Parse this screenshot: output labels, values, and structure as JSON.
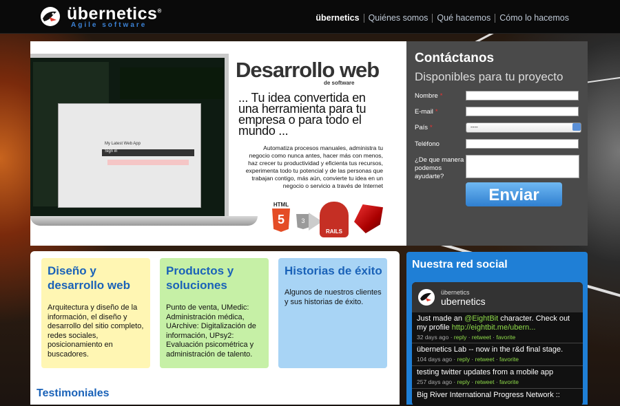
{
  "brand": {
    "name": "übernetics",
    "registered": "®",
    "tagline": "Agile software"
  },
  "nav": {
    "items": [
      "übernetics",
      "Quiénes somos",
      "Qué hacemos",
      "Cómo lo hacemos"
    ]
  },
  "hero": {
    "title": "Desarrollo web",
    "subtitle": "de software",
    "pitch": "... Tu idea convertida en una herramienta para tu empresa o para todo el mundo ...",
    "body": "Automatiza procesos manuales, administra tu negocio como nunca antes, hacer más con menos, haz crecer tu productividad y eficienta tus recursos, experimenta todo tu potencial y de las personas que trabajan contigo, más aún, convierte tu idea en un negocio o servicio a través de Internet",
    "badges": {
      "html": "HTML",
      "html5": "5",
      "css": "3",
      "rails": "RAILS"
    },
    "laptop": {
      "app_title": "My Latest Web App",
      "signin": "Sign in"
    }
  },
  "contact": {
    "title": "Contáctanos",
    "subtitle": "Disponibles para tu proyecto",
    "required_mark": "*",
    "fields": {
      "name_label": "Nombre",
      "email_label": "E-mail",
      "country_label": "País",
      "country_value": "----",
      "phone_label": "Teléfono",
      "message_label": "¿De que manera podemos ayudarte?"
    },
    "submit": "Enviar"
  },
  "cards": [
    {
      "title": "Diseño y desarrollo web",
      "text": "Arquitectura y diseño de la información, el diseño y desarrollo del sitio completo, redes sociales, posicionamiento en buscadores.",
      "color": "#fff6b3"
    },
    {
      "title": "Productos y soluciones",
      "text": "Punto de venta, UMedic: Administración médica, UArchive: Digitalización de información, UPsy2: Evaluación psicométrica y administración de talento.",
      "color": "#c6f0a6"
    },
    {
      "title": "Historias de éxito",
      "text": "Algunos de nuestros clientes y sus historias de éxito.",
      "color": "#a8d4f5"
    }
  ],
  "testimonials": {
    "title": "Testimoniales"
  },
  "social": {
    "title": "Nuestra red social",
    "account_small": "übernetics",
    "account_name": "ubernetics",
    "tweets": [
      {
        "pre": "Just made an ",
        "mention": "@EightBit",
        "mid": " character. Check out my profile ",
        "link": "http://eightbit.me/ubern...",
        "ago": "32 days ago",
        "reply": "reply",
        "retweet": "retweet",
        "favorite": "favorite"
      },
      {
        "pre": "übernetics Lab -- now in the r&d final stage.",
        "ago": "104 days ago",
        "reply": "reply",
        "retweet": "retweet",
        "favorite": "favorite"
      },
      {
        "pre": "testing twitter updates from a mobile app",
        "ago": "257 days ago",
        "reply": "reply",
        "retweet": "retweet",
        "favorite": "favorite"
      },
      {
        "pre": "Big River International Progress Network ::"
      }
    ],
    "meta_sep": " · "
  },
  "colors": {
    "accent": "#1f7fd6",
    "header": "#0a0a0a",
    "contact_bg": "#4a4a4a",
    "twitter_green": "#8fdb4a"
  }
}
